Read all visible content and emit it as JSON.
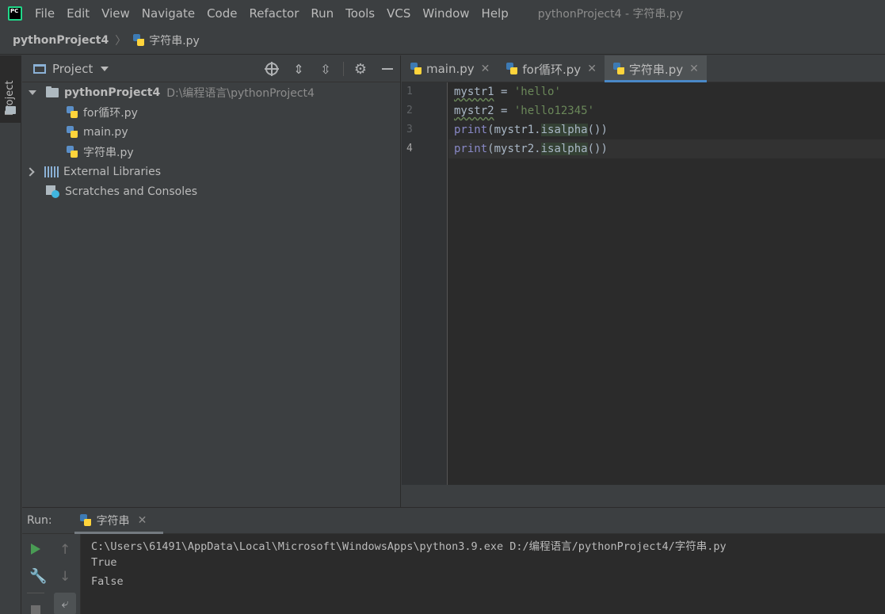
{
  "app": {
    "logo_text": "PC",
    "window_title": "pythonProject4 - 字符串.py"
  },
  "menu": [
    "File",
    "Edit",
    "View",
    "Navigate",
    "Code",
    "Refactor",
    "Run",
    "Tools",
    "VCS",
    "Window",
    "Help"
  ],
  "breadcrumb": {
    "project": "pythonProject4",
    "separator": "〉",
    "file": "字符串.py"
  },
  "left_strip": {
    "project_label": "Project"
  },
  "project_panel": {
    "header_label": "Project",
    "tree": {
      "root": {
        "name": "pythonProject4",
        "path": "D:\\编程语言\\pythonProject4"
      },
      "files": [
        "for循环.py",
        "main.py",
        "字符串.py"
      ],
      "external_libraries": "External Libraries",
      "scratches": "Scratches and Consoles"
    }
  },
  "editor_tabs": [
    {
      "label": "main.py",
      "active": false
    },
    {
      "label": "for循环.py",
      "active": false
    },
    {
      "label": "字符串.py",
      "active": true
    }
  ],
  "editor": {
    "line_numbers": [
      "1",
      "2",
      "3",
      "4"
    ],
    "lines": [
      {
        "var": "mystr1",
        "op": " = ",
        "str": "'hello'"
      },
      {
        "var": "mystr2",
        "op": " = ",
        "str": "'hello12345'"
      },
      {
        "builtin": "print",
        "open": "(mystr1.",
        "method": "isalpha",
        "close": "())"
      },
      {
        "builtin": "print",
        "open": "(mystr2.",
        "method": "isalpha",
        "close": "())"
      }
    ]
  },
  "run_panel": {
    "title": "Run:",
    "tab_label": "字符串",
    "console": [
      "C:\\Users\\61491\\AppData\\Local\\Microsoft\\WindowsApps\\python3.9.exe D:/编程语言/pythonProject4/字符串.py",
      "True",
      "False"
    ]
  },
  "icons": {
    "close": "✕",
    "gear": "⚙",
    "wrench": "🔧",
    "up": "↑",
    "down": "↓",
    "softwrap": "⤶",
    "expand": "⇕",
    "collapse": "⇳",
    "minimize": "—"
  },
  "colors": {
    "string": "#6a8759",
    "builtin": "#8888c6",
    "accent": "#4a88c7",
    "run_green": "#499c54"
  }
}
